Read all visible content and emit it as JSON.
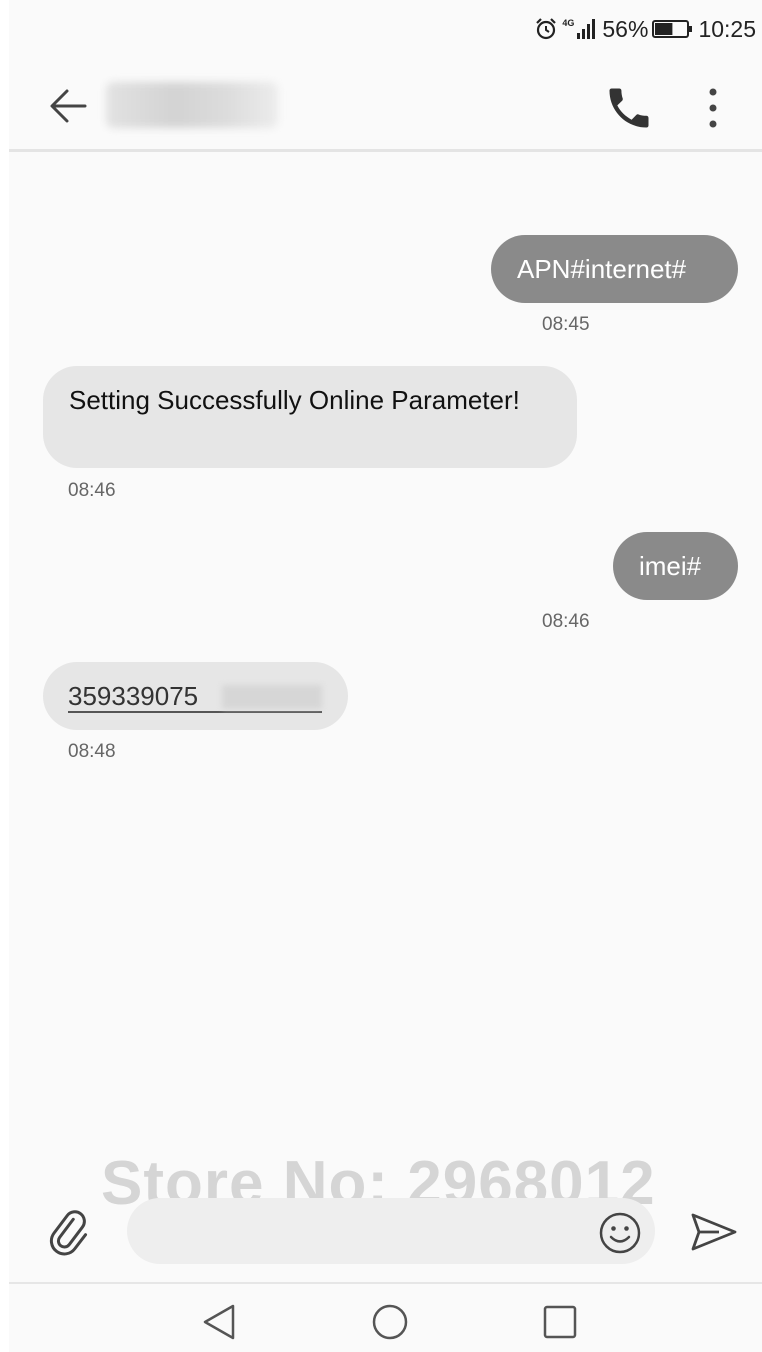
{
  "status_bar": {
    "network_type": "4G",
    "battery_percent": "56%",
    "battery_level": 0.56,
    "time": "10:25",
    "icons": [
      "alarm-icon",
      "signal-icon",
      "battery-icon"
    ]
  },
  "app_bar": {
    "contact_name": "",
    "icons": [
      "back-arrow-icon",
      "phone-icon",
      "more-vert-icon"
    ]
  },
  "messages": [
    {
      "direction": "sent",
      "text": "APN#internet#",
      "time": "08:45"
    },
    {
      "direction": "received",
      "text": "Setting Successfully Online Parameter!",
      "time": "08:46"
    },
    {
      "direction": "sent",
      "text": "imei#",
      "time": "08:46"
    },
    {
      "direction": "received",
      "text": "359339075",
      "time": "08:48"
    }
  ],
  "watermark": "Store No: 2968012",
  "compose": {
    "value": "",
    "placeholder": "",
    "icons": [
      "paperclip-icon",
      "emoji-icon",
      "send-icon"
    ]
  },
  "nav_bar": {
    "icons": [
      "nav-back-icon",
      "nav-home-icon",
      "nav-recents-icon"
    ]
  },
  "colors": {
    "sent_bubble": "#8a8a8a",
    "received_bubble": "#e6e6e6",
    "background": "#fafafa"
  }
}
